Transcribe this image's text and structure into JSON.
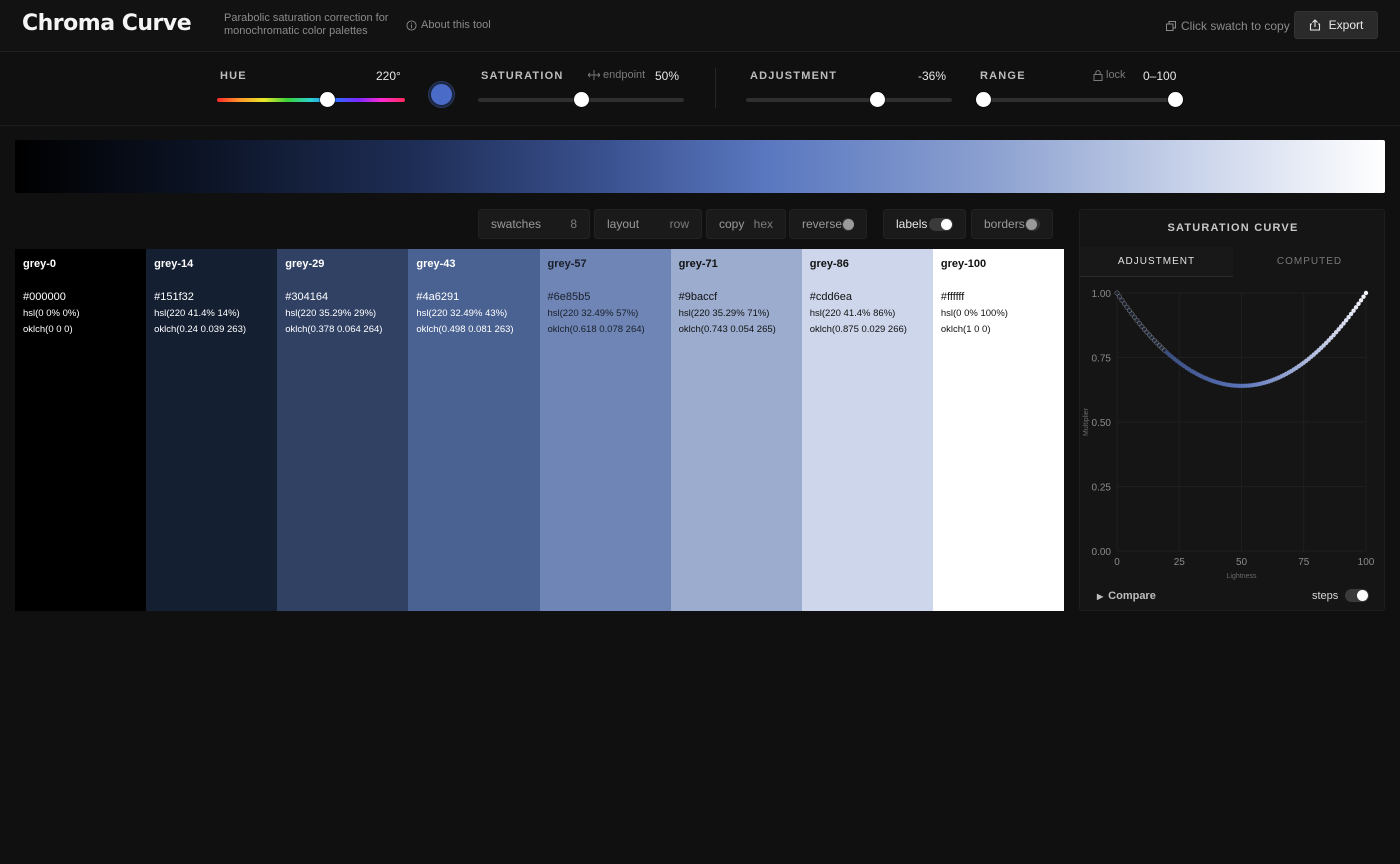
{
  "header": {
    "title": "Chroma Curve",
    "subtitle": "Parabolic saturation correction for monochromatic color palettes",
    "about_label": "About this tool",
    "copy_hint": "Click swatch to copy",
    "export_label": "Export"
  },
  "controls": {
    "hue": {
      "label": "HUE",
      "value": "220°",
      "fraction": 0.59,
      "swatch_color": "#4a6cc8"
    },
    "saturation": {
      "label": "SATURATION",
      "endpoint_label": "endpoint",
      "value": "50%",
      "fraction": 0.5
    },
    "adjustment": {
      "label": "ADJUSTMENT",
      "value": "-36%",
      "fraction": 0.64
    },
    "range": {
      "label": "RANGE",
      "lock_label": "lock",
      "value": "0–100",
      "min": 0,
      "max": 100
    }
  },
  "toolbar": {
    "swatches": {
      "label": "swatches",
      "value": "8"
    },
    "layout": {
      "label": "layout",
      "value": "row"
    },
    "copy": {
      "label": "copy",
      "value": "hex"
    },
    "reverse": {
      "label": "reverse",
      "on": false
    },
    "labels": {
      "label": "labels",
      "on": true
    },
    "borders": {
      "label": "borders",
      "on": false
    }
  },
  "swatches": [
    {
      "name": "grey-0",
      "hex": "#000000",
      "hsl": "hsl(0 0% 0%)",
      "oklch": "oklch(0 0 0)",
      "text_color": "#ffffff"
    },
    {
      "name": "grey-14",
      "hex": "#151f32",
      "hsl": "hsl(220 41.4% 14%)",
      "oklch": "oklch(0.24 0.039 263)",
      "text_color": "#ffffff"
    },
    {
      "name": "grey-29",
      "hex": "#304164",
      "hsl": "hsl(220 35.29% 29%)",
      "oklch": "oklch(0.378 0.064 264)",
      "text_color": "#ffffff"
    },
    {
      "name": "grey-43",
      "hex": "#4a6291",
      "hsl": "hsl(220 32.49% 43%)",
      "oklch": "oklch(0.498 0.081 263)",
      "text_color": "#ffffff"
    },
    {
      "name": "grey-57",
      "hex": "#6e85b5",
      "hsl": "hsl(220 32.49% 57%)",
      "oklch": "oklch(0.618 0.078 264)",
      "text_color": "#1a1f2a"
    },
    {
      "name": "grey-71",
      "hex": "#9baccf",
      "hsl": "hsl(220 35.29% 71%)",
      "oklch": "oklch(0.743 0.054 265)",
      "text_color": "#111111"
    },
    {
      "name": "grey-86",
      "hex": "#cdd6ea",
      "hsl": "hsl(220 41.4% 86%)",
      "oklch": "oklch(0.875 0.029 266)",
      "text_color": "#111111"
    },
    {
      "name": "grey-100",
      "hex": "#ffffff",
      "hsl": "hsl(0 0% 100%)",
      "oklch": "oklch(1 0 0)",
      "text_color": "#111111"
    }
  ],
  "curve_panel": {
    "title": "SATURATION CURVE",
    "tabs": [
      "ADJUSTMENT",
      "COMPUTED"
    ],
    "active_tab": 0,
    "compare_label": "Compare",
    "steps_label": "steps",
    "steps_on": true
  },
  "chart_data": {
    "type": "scatter",
    "title": "",
    "xlabel": "Lightness",
    "ylabel": "Multiplier",
    "xlim": [
      0,
      100
    ],
    "ylim": [
      0,
      1
    ],
    "x_ticks": [
      "0",
      "25",
      "50",
      "75",
      "100"
    ],
    "y_ticks": [
      "0.00",
      "0.25",
      "0.50",
      "0.75",
      "1.00"
    ],
    "grid": true,
    "curve": {
      "form": "parabola",
      "min_at_x": 50,
      "min_y": 0.64,
      "max_y": 1.0,
      "points": 101
    }
  }
}
